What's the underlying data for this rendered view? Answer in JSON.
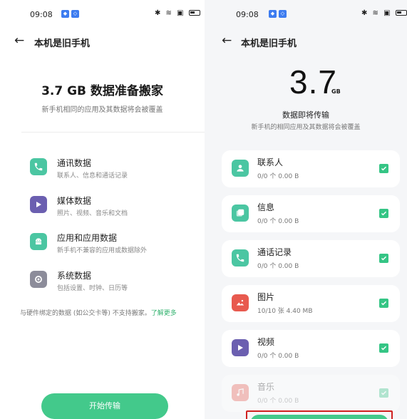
{
  "colors": {
    "accent": "#43c98b",
    "contact_teal": "#4bc6a2",
    "media_purple": "#6b5fb0",
    "system_gray": "#8c8c9a",
    "picture_red": "#e85a4f",
    "highlight_red": "#d02020"
  },
  "left": {
    "status": {
      "time": "09:08"
    },
    "nav": {
      "back_icon": "arrow-left-icon",
      "title": "本机是旧手机"
    },
    "headline": "3.7 GB 数据准备搬家",
    "subtitle": "新手机相同的应用及其数据将会被覆盖",
    "categories": [
      {
        "icon": "phone-icon",
        "name": "通讯数据",
        "desc": "联系人、信息和通话记录"
      },
      {
        "icon": "play-icon",
        "name": "媒体数据",
        "desc": "照片、视频、音乐和文档"
      },
      {
        "icon": "android-icon",
        "name": "应用和应用数据",
        "desc": "新手机不兼容的应用或数据除外"
      },
      {
        "icon": "gear-icon",
        "name": "系统数据",
        "desc": "包括设置、时钟、日历等"
      }
    ],
    "note": "与硬件绑定的数据 (如公交卡等) 不支持搬家。",
    "note_link": "了解更多",
    "start_button": "开始传输"
  },
  "right": {
    "status": {
      "time": "09:08"
    },
    "nav": {
      "back_icon": "arrow-left-icon",
      "title": "本机是旧手机"
    },
    "size_value": "3.7",
    "size_unit": "GB",
    "title": "数据即将传输",
    "subtitle": "新手机的相同应用及其数据将会被覆盖",
    "items": [
      {
        "icon": "contact-icon",
        "name": "联系人",
        "count": "0/0 个    0.00 B",
        "checked": true
      },
      {
        "icon": "message-icon",
        "name": "信息",
        "count": "0/0 个    0.00 B",
        "checked": true
      },
      {
        "icon": "phone-icon",
        "name": "通话记录",
        "count": "0/0 个    0.00 B",
        "checked": true
      },
      {
        "icon": "picture-icon",
        "name": "图片",
        "count": "10/10 张    4.40 MB",
        "checked": true
      },
      {
        "icon": "video-icon",
        "name": "视频",
        "count": "0/0 个    0.00 B",
        "checked": true
      },
      {
        "icon": "music-icon",
        "name": "音乐",
        "count": "0/0 个    0.00 B",
        "checked": true
      }
    ]
  }
}
